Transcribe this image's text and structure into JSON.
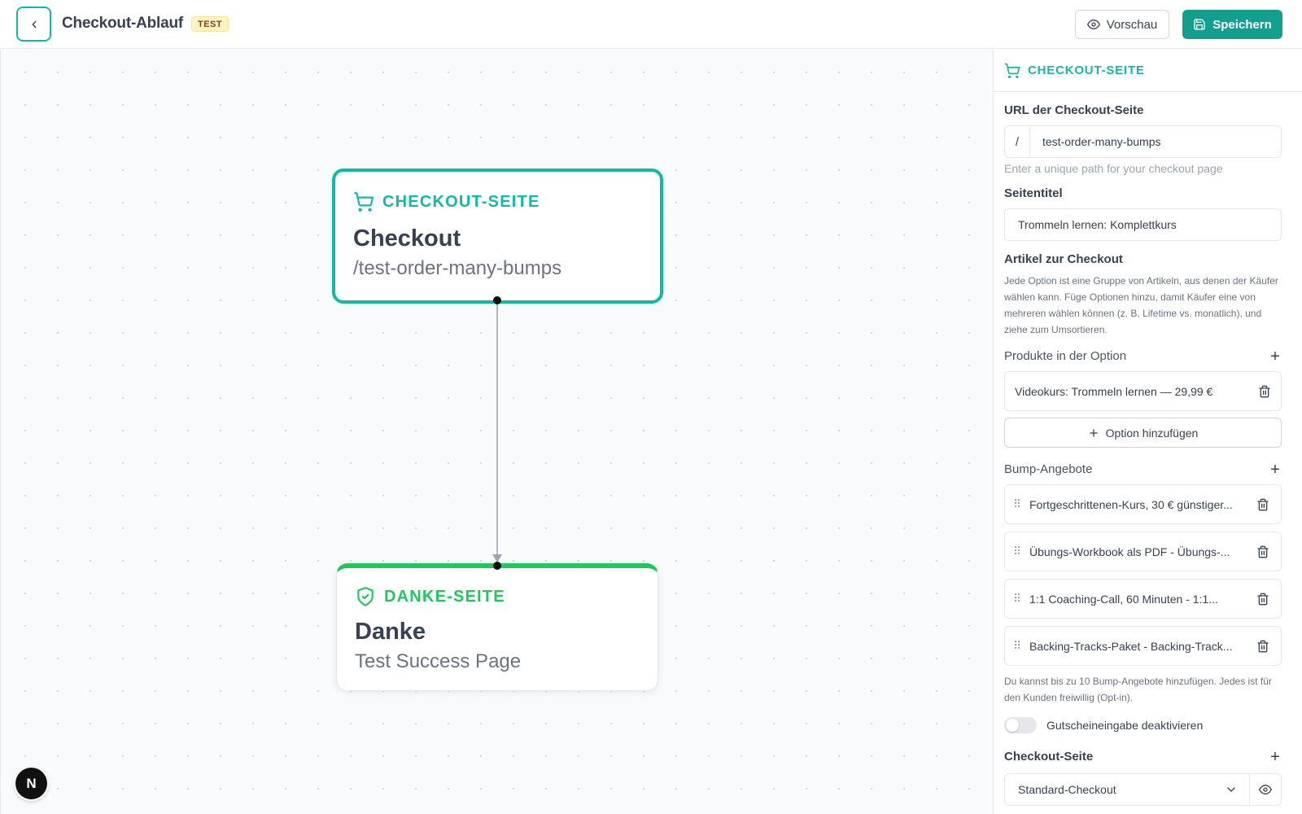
{
  "header": {
    "title": "Checkout-Ablauf",
    "badge": "TEST",
    "preview_label": "Vorschau",
    "save_label": "Speichern",
    "accent_color": "#14b8a6"
  },
  "canvas": {
    "nodes": [
      {
        "kind": "CHECKOUT-SEITE",
        "title": "Checkout",
        "subtitle": "/test-order-many-bumps",
        "color": "#14b8a6",
        "icon": "cart-icon"
      },
      {
        "kind": "DANKE-SEITE",
        "title": "Danke",
        "subtitle": "Test Success Page",
        "color": "#22c55e",
        "icon": "shield-check-icon"
      }
    ],
    "badge_letter": "N"
  },
  "panel": {
    "heading": "CHECKOUT-SEITE",
    "url": {
      "label": "URL der Checkout-Seite",
      "prefix": "/",
      "value": "test-order-many-bumps",
      "hint": "Enter a unique path for your checkout page"
    },
    "page_title": {
      "label": "Seitentitel",
      "value": "Trommeln lernen: Komplettkurs"
    },
    "articles": {
      "label": "Artikel zur Checkout",
      "description": "Jede Option ist eine Gruppe von Artikeln, aus denen der Käufer wählen kann. Füge Optionen hinzu, damit Käufer eine von mehreren wählen können (z. B. Lifetime vs. monatlich), und ziehe zum Umsortieren."
    },
    "products": {
      "label": "Produkte in der Option",
      "add_symbol": "+",
      "items": [
        "Videokurs: Trommeln lernen — 29,99 €"
      ],
      "add_option_label": "Option hinzufügen"
    },
    "bumps": {
      "label": "Bump-Angebote",
      "add_symbol": "+",
      "items": [
        "Fortgeschrittenen-Kurs, 30 € günstiger...",
        "Übungs-Workbook als PDF - Übungs-...",
        "1:1 Coaching-Call, 60 Minuten - 1:1...",
        "Backing-Tracks-Paket - Backing-Track..."
      ],
      "note": "Du kannst bis zu 10 Bump-Angebote hinzufügen. Jedes ist für den Kunden freiwillig (Opt-in)."
    },
    "coupon_toggle": {
      "label": "Gutscheineingabe deaktivieren",
      "enabled": false
    },
    "checkout_page": {
      "label": "Checkout-Seite",
      "add_symbol": "+",
      "selected": "Standard-Checkout"
    }
  }
}
